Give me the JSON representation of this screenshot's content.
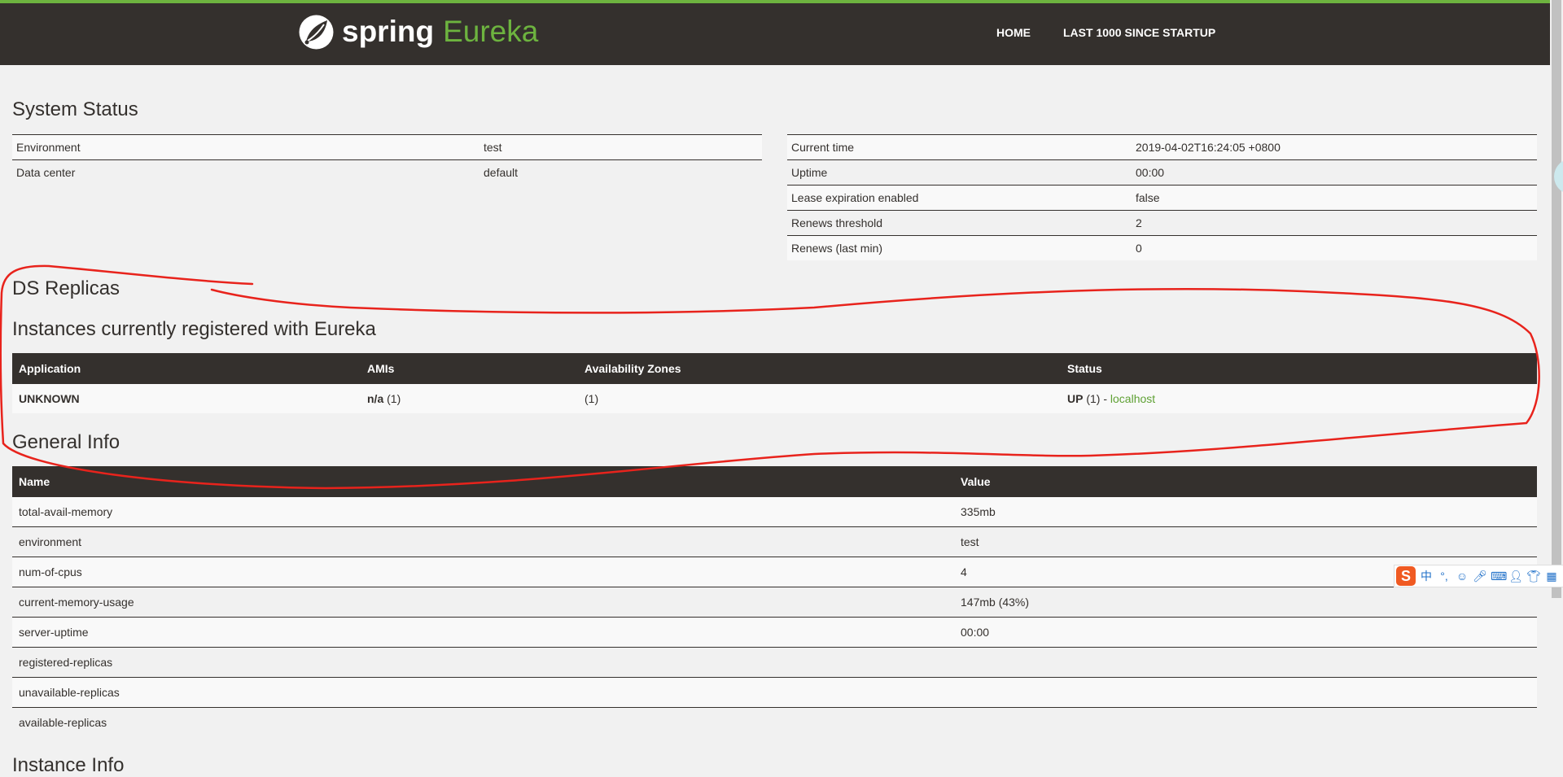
{
  "brand": {
    "spring": "spring",
    "eureka": "Eureka",
    "accent_color": "#6db33f",
    "dark_color": "#34302d"
  },
  "nav": {
    "home": "HOME",
    "last1000": "LAST 1000 SINCE STARTUP"
  },
  "system_status": {
    "title": "System Status",
    "left": [
      {
        "label": "Environment",
        "value": "test"
      },
      {
        "label": "Data center",
        "value": "default"
      }
    ],
    "right": [
      {
        "label": "Current time",
        "value": "2019-04-02T16:24:05 +0800"
      },
      {
        "label": "Uptime",
        "value": "00:00"
      },
      {
        "label": "Lease expiration enabled",
        "value": "false"
      },
      {
        "label": "Renews threshold",
        "value": "2"
      },
      {
        "label": "Renews (last min)",
        "value": "0"
      }
    ]
  },
  "ds_replicas": {
    "title": "DS Replicas"
  },
  "instances": {
    "title": "Instances currently registered with Eureka",
    "headers": {
      "application": "Application",
      "amis": "AMIs",
      "zones": "Availability Zones",
      "status": "Status"
    },
    "rows": [
      {
        "application": "UNKNOWN",
        "amis_value": "n/a",
        "amis_count": "(1)",
        "zones": "(1)",
        "status": "UP",
        "status_count": "(1) -",
        "instance": "localhost"
      }
    ]
  },
  "general_info": {
    "title": "General Info",
    "headers": {
      "name": "Name",
      "value": "Value"
    },
    "rows": [
      {
        "name": "total-avail-memory",
        "value": "335mb"
      },
      {
        "name": "environment",
        "value": "test"
      },
      {
        "name": "num-of-cpus",
        "value": "4"
      },
      {
        "name": "current-memory-usage",
        "value": "147mb (43%)"
      },
      {
        "name": "server-uptime",
        "value": "00:00"
      },
      {
        "name": "registered-replicas",
        "value": ""
      },
      {
        "name": "unavailable-replicas",
        "value": ""
      },
      {
        "name": "available-replicas",
        "value": ""
      }
    ]
  },
  "instance_info": {
    "title": "Instance Info"
  },
  "ime_toolbar": {
    "logo": "S",
    "lang": "中",
    "punct": "°,",
    "items": [
      "emoji-icon",
      "microphone-icon",
      "keyboard-icon",
      "user-icon",
      "shirt-icon",
      "grid-icon"
    ]
  },
  "annotation_color": "#e8231c"
}
